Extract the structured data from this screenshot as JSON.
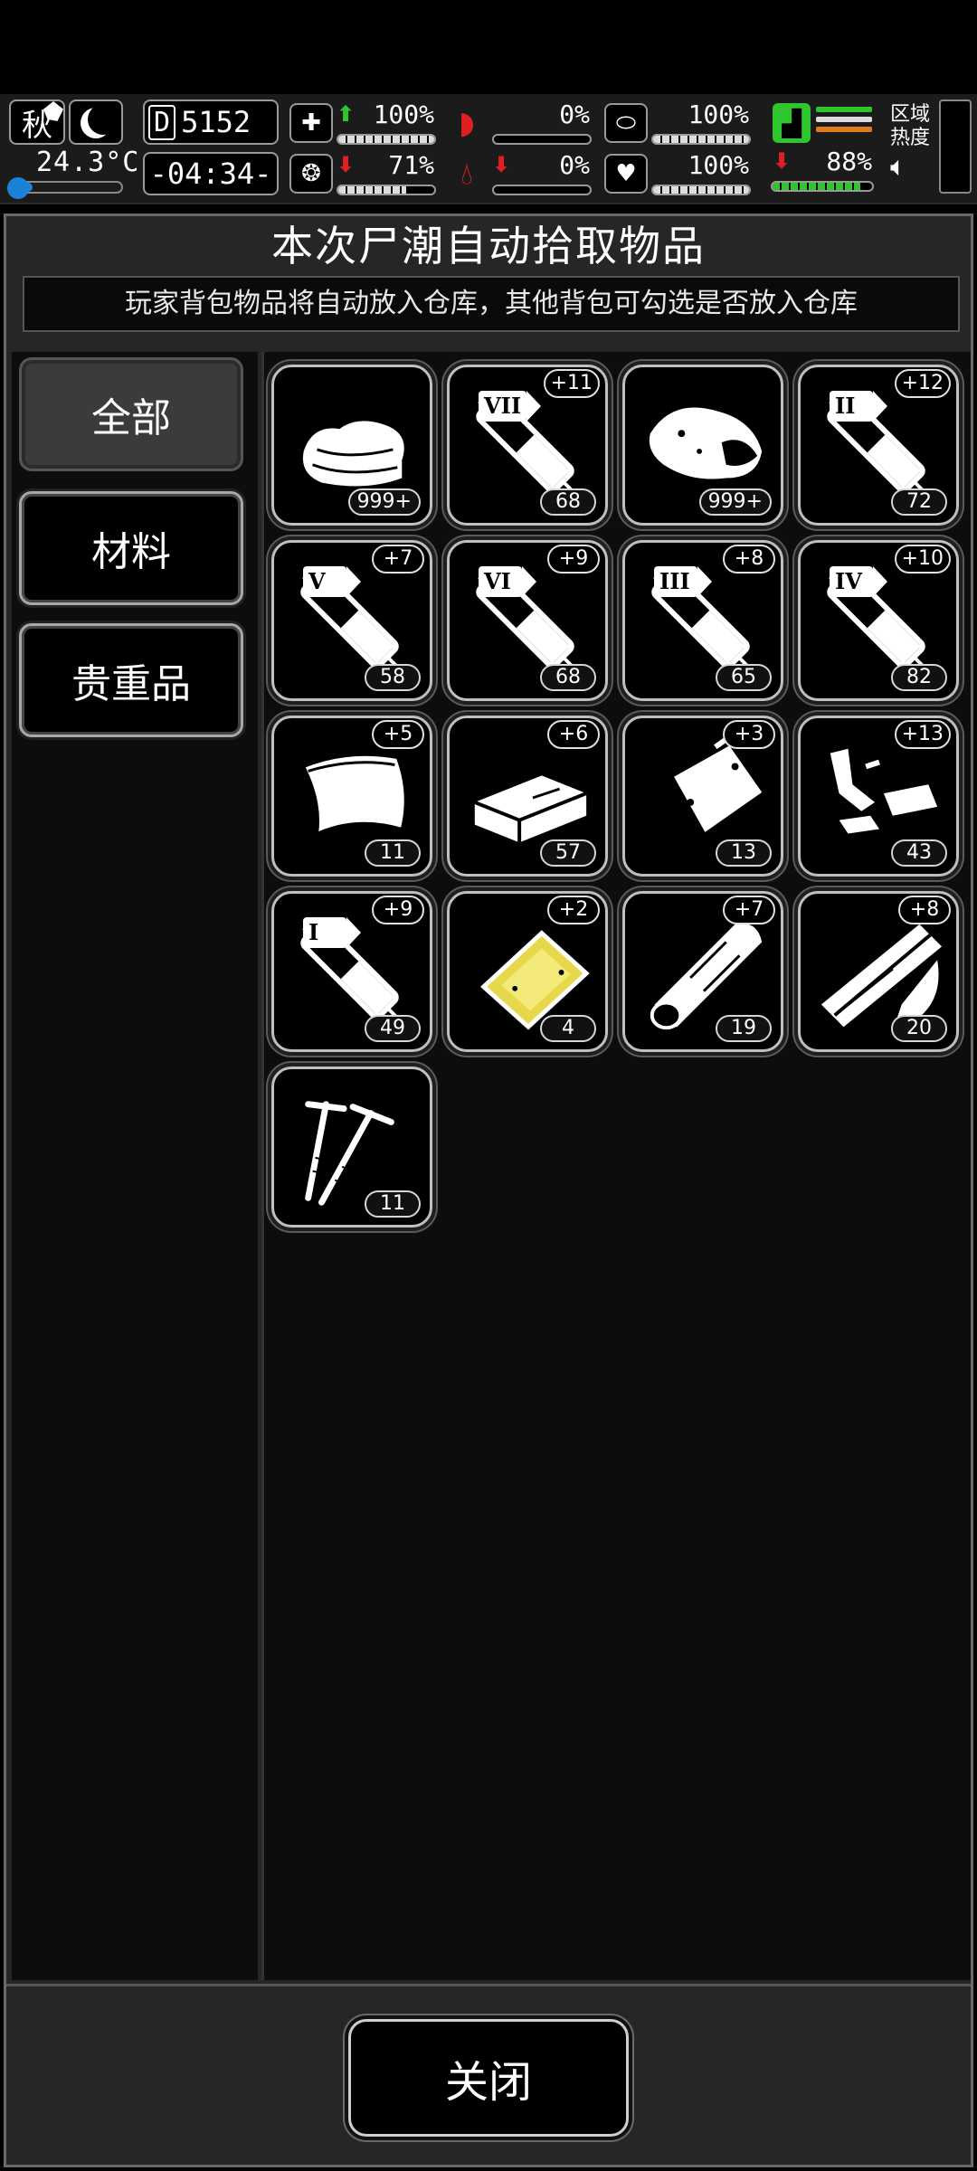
{
  "status": {
    "season": "秋",
    "temperature": "24.3°C",
    "temperature_level": 0.2,
    "day_letter": "D",
    "day_number": "5152",
    "clock": "-04:34-",
    "stats": [
      {
        "icon": "medkit-icon",
        "arrow": "up",
        "value": "100%",
        "level": 1.0
      },
      {
        "icon": "stomach-icon",
        "arrow": "",
        "value": "0%",
        "level": 0.0
      },
      {
        "icon": "capsule-icon",
        "arrow": "",
        "value": "100%",
        "level": 1.0
      },
      {
        "icon": "brain-icon",
        "arrow": "down",
        "value": "71%",
        "level": 0.71
      },
      {
        "icon": "blood-drop-icon",
        "arrow": "down",
        "value": "0%",
        "level": 0.0
      },
      {
        "icon": "heart-icon",
        "arrow": "",
        "value": "100%",
        "level": 1.0
      }
    ],
    "stamina": {
      "arrow": "down",
      "value": "88%",
      "level": 0.88
    },
    "region_label": "区域热度"
  },
  "panel": {
    "title": "本次尸潮自动拾取物品",
    "subtitle": "玩家背包物品将自动放入仓库，其他背包可勾选是否放入仓库"
  },
  "tabs": [
    {
      "label": "全部",
      "active": true
    },
    {
      "label": "材料",
      "active": false
    },
    {
      "label": "贵重品",
      "active": false
    }
  ],
  "items": [
    {
      "icon": "cloth-icon",
      "count": "999+",
      "bonus": "",
      "roman": ""
    },
    {
      "icon": "syringe-icon",
      "count": "68",
      "bonus": "+11",
      "roman": "VII"
    },
    {
      "icon": "meat-icon",
      "count": "999+",
      "bonus": "",
      "roman": ""
    },
    {
      "icon": "syringe-icon",
      "count": "72",
      "bonus": "+12",
      "roman": "II"
    },
    {
      "icon": "syringe-icon",
      "count": "58",
      "bonus": "+7",
      "roman": "V"
    },
    {
      "icon": "syringe-icon",
      "count": "68",
      "bonus": "+9",
      "roman": "VI"
    },
    {
      "icon": "syringe-icon",
      "count": "65",
      "bonus": "+8",
      "roman": "III"
    },
    {
      "icon": "syringe-icon",
      "count": "82",
      "bonus": "+10",
      "roman": "IV"
    },
    {
      "icon": "metal-sheet-icon",
      "count": "11",
      "bonus": "+5",
      "roman": ""
    },
    {
      "icon": "brick-icon",
      "count": "57",
      "bonus": "+6",
      "roman": ""
    },
    {
      "icon": "plastic-bag-icon",
      "count": "13",
      "bonus": "+3",
      "roman": ""
    },
    {
      "icon": "scrap-parts-icon",
      "count": "43",
      "bonus": "+13",
      "roman": ""
    },
    {
      "icon": "syringe-icon",
      "count": "49",
      "bonus": "+9",
      "roman": "I"
    },
    {
      "icon": "gold-plate-icon",
      "count": "4",
      "bonus": "+2",
      "roman": ""
    },
    {
      "icon": "wood-log-icon",
      "count": "19",
      "bonus": "+7",
      "roman": ""
    },
    {
      "icon": "planks-icon",
      "count": "20",
      "bonus": "+8",
      "roman": ""
    },
    {
      "icon": "nails-icon",
      "count": "11",
      "bonus": "",
      "roman": ""
    }
  ],
  "close_label": "关闭",
  "colors": {
    "accent_green": "#2ec52e",
    "accent_red": "#e02020",
    "temp_blue": "#1a82d9",
    "gold": "#e6d84a"
  }
}
